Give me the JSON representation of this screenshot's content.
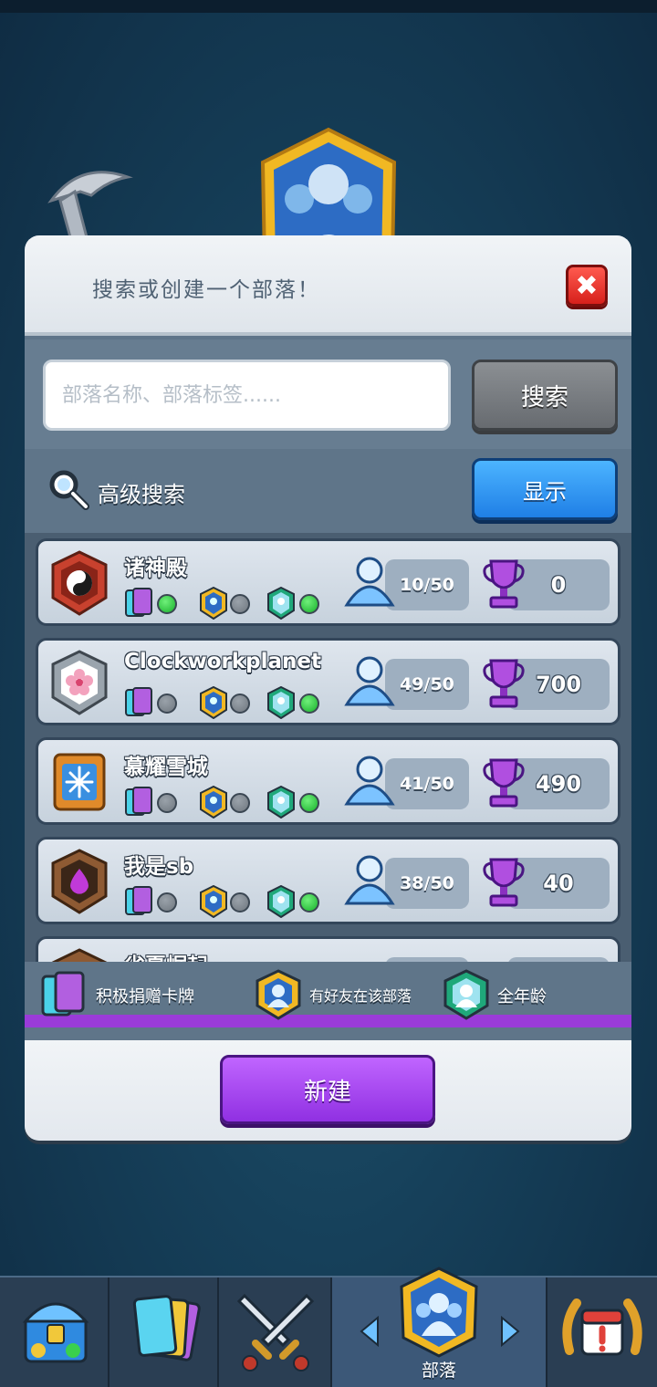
{
  "dialog": {
    "title": "搜索或创建一个部落！",
    "close_symbol": "✖"
  },
  "search": {
    "placeholder": "部落名称、部落标签......",
    "value": "",
    "button_label": "搜索"
  },
  "advanced": {
    "label": "高级搜索",
    "button_label": "显示"
  },
  "clans": [
    {
      "name": "诸神殿",
      "members": "10/50",
      "trophies": "0",
      "badge": "yin-yang-badge",
      "donates": true,
      "friends": false,
      "all_ages": true
    },
    {
      "name": "Clockworkplanet",
      "members": "49/50",
      "trophies": "700",
      "badge": "sakura-badge",
      "donates": false,
      "friends": false,
      "all_ages": true
    },
    {
      "name": "慕耀雪城",
      "members": "41/50",
      "trophies": "490",
      "badge": "snowflake-badge",
      "donates": false,
      "friends": false,
      "all_ages": true
    },
    {
      "name": "我是sb",
      "members": "38/50",
      "trophies": "40",
      "badge": "drop-badge",
      "donates": false,
      "friends": false,
      "all_ages": true
    },
    {
      "name": "省夏崛起",
      "members": "",
      "trophies": "",
      "badge": "partial-badge"
    }
  ],
  "legend": {
    "donates": "积极捐赠卡牌",
    "friends": "有好友在该部落",
    "all_ages": "全年龄"
  },
  "new_button_label": "新建",
  "nav": {
    "shop_icon": "chest-icon",
    "cards_icon": "cards-icon",
    "battle_icon": "crossed-swords-icon",
    "clan_label": "部落",
    "events_icon": "calendar-laurel-icon"
  },
  "colors": {
    "accent_blue": "#1f7fe6",
    "accent_purple": "#9030e2",
    "close_red": "#d7201b",
    "status_on": "#19b02c",
    "status_off": "#6f777f"
  }
}
